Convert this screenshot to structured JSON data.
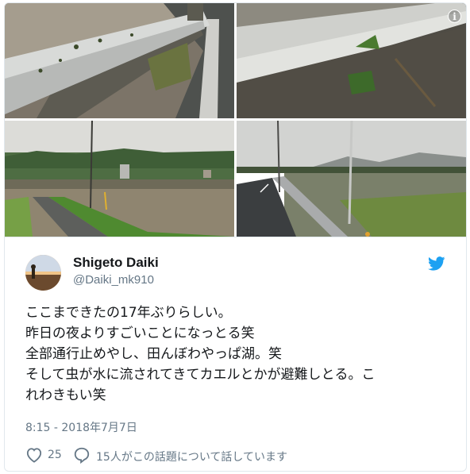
{
  "tweet": {
    "author_name": "Shigeto Daiki",
    "author_handle": "@Daiki_mk910",
    "text_lines": [
      "ここまできたの17年ぶりらしい。",
      "昨日の夜よりすごいことになっとる笑",
      "全部通行止めやし、田んぼわやっぱ湖。笑",
      "そして虫が水に流されてきてカエルとかが避難しとる。こ",
      "れわきもい笑"
    ],
    "timestamp": "8:15 - 2018年7月7日",
    "like_count": "25",
    "talking_text": "15人がこの話題について話しています"
  },
  "media": {
    "photo_count": 4,
    "info_icon": "i"
  },
  "icons": {
    "info": "info-icon",
    "bird": "twitter-bird-icon",
    "heart": "heart-icon",
    "comment": "comment-bubble-icon"
  },
  "colors": {
    "brand": "#1da1f2",
    "secondary_text": "#657786",
    "primary_text": "#14171a",
    "border": "#e1e8ed"
  }
}
